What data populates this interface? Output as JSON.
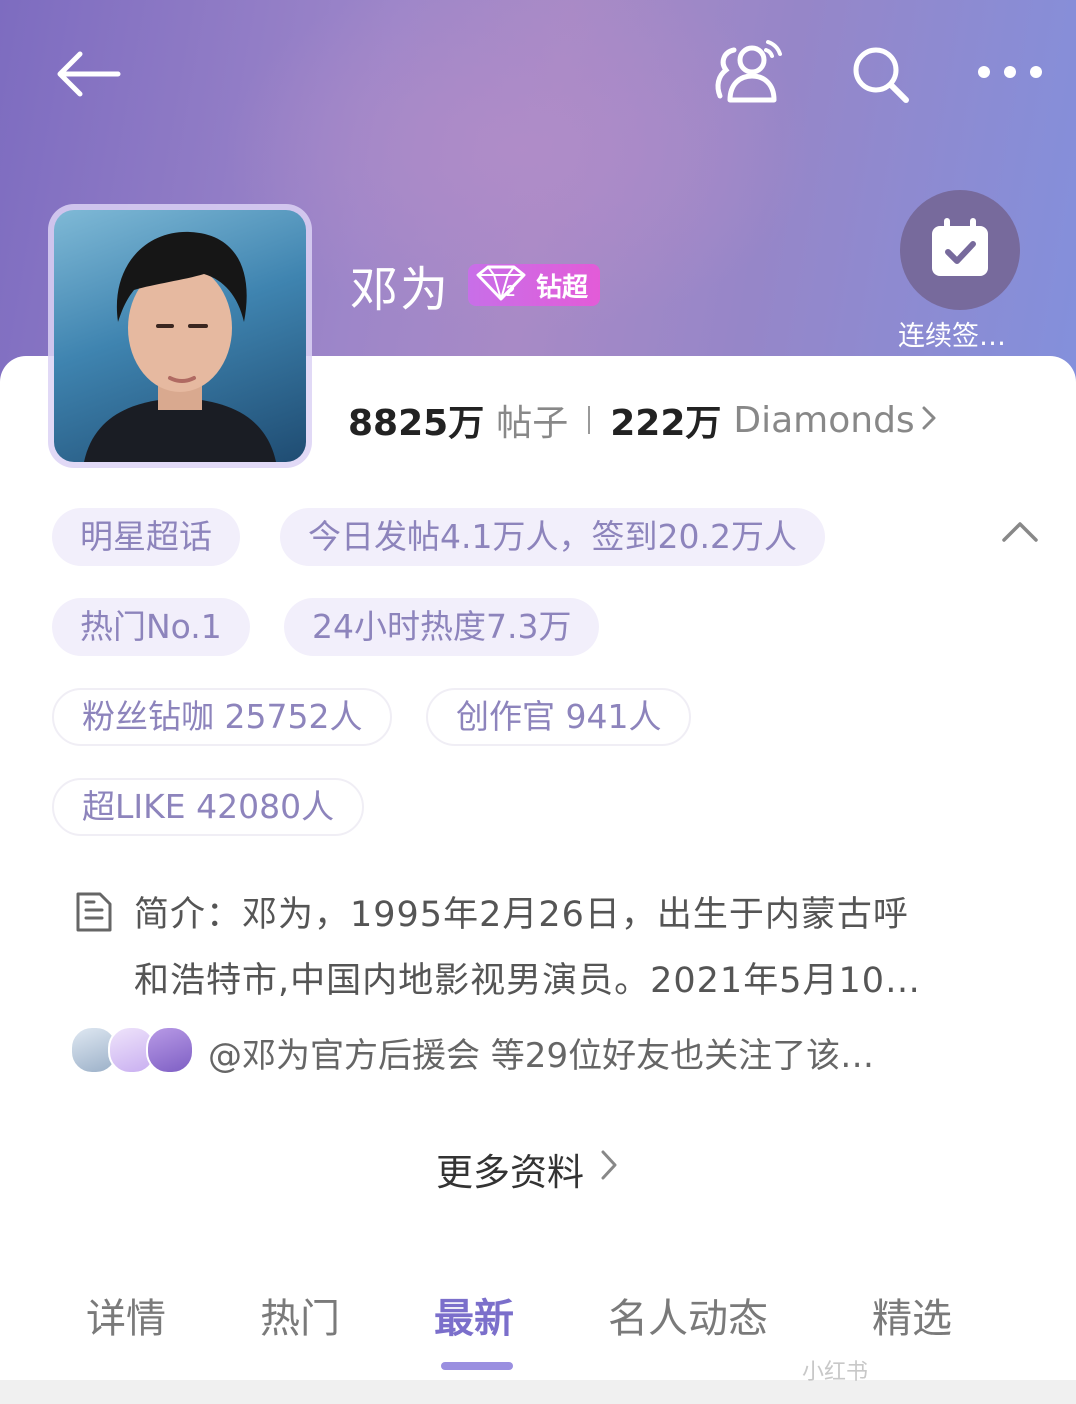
{
  "profile": {
    "name": "邓为",
    "badge_label": "钻超",
    "posts_count": "8825万",
    "posts_label": "帖子",
    "diamonds_count": "222万",
    "diamonds_label": "Diamonds"
  },
  "checkin": {
    "label": "连续签…"
  },
  "tags": [
    {
      "label": "明星超话"
    },
    {
      "label": "今日发帖4.1万人，签到20.2万人"
    },
    {
      "label": "热门No.1"
    },
    {
      "label": "24小时热度7.3万"
    },
    {
      "label": "粉丝钻咖 25752人"
    },
    {
      "label": "创作官 941人"
    },
    {
      "label": "超LIKE 42080人"
    }
  ],
  "intro": {
    "line1": "简介：邓为，1995年2月26日，出生于内蒙古呼",
    "line2": "和浩特市,中国内地影视男演员。2021年5月10…"
  },
  "followers": {
    "text": "@邓为官方后援会 等29位好友也关注了该…"
  },
  "more_info": {
    "label": "更多资料"
  },
  "tabs": [
    {
      "label": "详情"
    },
    {
      "label": "热门"
    },
    {
      "label": "最新",
      "active": true
    },
    {
      "label": "名人动态"
    },
    {
      "label": "精选"
    }
  ],
  "watermark": "小红书",
  "colors": {
    "accent": "#7b6fcb",
    "tag_text": "#8d84bc",
    "tag_bg": "#f2effb",
    "badge": "#d965e0"
  },
  "icons": {
    "back": "arrow-left-icon",
    "friends": "friends-icon",
    "search": "search-icon",
    "more": "more-dots-icon",
    "checkin": "calendar-check-icon",
    "intro": "document-icon",
    "collapse": "chevron-up-icon"
  }
}
